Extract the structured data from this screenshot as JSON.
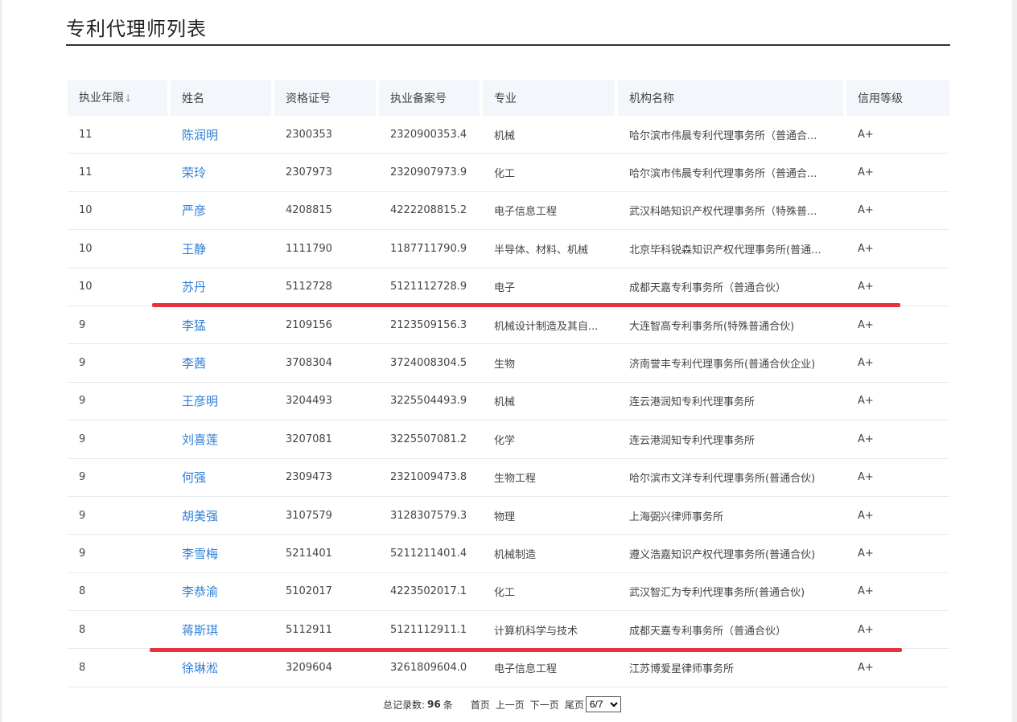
{
  "title": "专利代理师列表",
  "columns": [
    "执业年限",
    "姓名",
    "资格证号",
    "执业备案号",
    "专业",
    "机构名称",
    "信用等级"
  ],
  "sort_indicator": "arrow-down-icon",
  "rows": [
    {
      "years": "11",
      "name": "陈润明",
      "cert": "2300353",
      "record": "2320900353.4",
      "major": "机械",
      "org": "哈尔滨市伟晨专利代理事务所（普通合...",
      "credit": "A+"
    },
    {
      "years": "11",
      "name": "荣玲",
      "cert": "2307973",
      "record": "2320907973.9",
      "major": "化工",
      "org": "哈尔滨市伟晨专利代理事务所（普通合...",
      "credit": "A+"
    },
    {
      "years": "10",
      "name": "严彦",
      "cert": "4208815",
      "record": "4222208815.2",
      "major": "电子信息工程",
      "org": "武汉科皓知识产权代理事务所（特殊普...",
      "credit": "A+"
    },
    {
      "years": "10",
      "name": "王静",
      "cert": "1111790",
      "record": "1187711790.9",
      "major": "半导体、材料、机械",
      "org": "北京毕科锐森知识产权代理事务所(普通...",
      "credit": "A+"
    },
    {
      "years": "10",
      "name": "苏丹",
      "cert": "5112728",
      "record": "5121112728.9",
      "major": "电子",
      "org": "成都天嘉专利事务所（普通合伙）",
      "credit": "A+"
    },
    {
      "years": "9",
      "name": "李猛",
      "cert": "2109156",
      "record": "2123509156.3",
      "major": "机械设计制造及其自...",
      "org": "大连智高专利事务所(特殊普通合伙)",
      "credit": "A+"
    },
    {
      "years": "9",
      "name": "李茜",
      "cert": "3708304",
      "record": "3724008304.5",
      "major": "生物",
      "org": "济南誉丰专利代理事务所(普通合伙企业)",
      "credit": "A+"
    },
    {
      "years": "9",
      "name": "王彦明",
      "cert": "3204493",
      "record": "3225504493.9",
      "major": "机械",
      "org": "连云港润知专利代理事务所",
      "credit": "A+"
    },
    {
      "years": "9",
      "name": "刘喜莲",
      "cert": "3207081",
      "record": "3225507081.2",
      "major": "化学",
      "org": "连云港润知专利代理事务所",
      "credit": "A+"
    },
    {
      "years": "9",
      "name": "何强",
      "cert": "2309473",
      "record": "2321009473.8",
      "major": "生物工程",
      "org": "哈尔滨市文洋专利代理事务所(普通合伙)",
      "credit": "A+"
    },
    {
      "years": "9",
      "name": "胡美强",
      "cert": "3107579",
      "record": "3128307579.3",
      "major": "物理",
      "org": "上海弼兴律师事务所",
      "credit": "A+"
    },
    {
      "years": "9",
      "name": "李雪梅",
      "cert": "5211401",
      "record": "5211211401.4",
      "major": "机械制造",
      "org": "遵义浩嘉知识产权代理事务所(普通合伙)",
      "credit": "A+"
    },
    {
      "years": "8",
      "name": "李恭渝",
      "cert": "5102017",
      "record": "4223502017.1",
      "major": "化工",
      "org": "武汉智汇为专利代理事务所(普通合伙)",
      "credit": "A+"
    },
    {
      "years": "8",
      "name": "蒋斯琪",
      "cert": "5112911",
      "record": "5121112911.1",
      "major": "计算机科学与技术",
      "org": "成都天嘉专利事务所（普通合伙）",
      "credit": "A+"
    },
    {
      "years": "8",
      "name": "徐琳淞",
      "cert": "3209604",
      "record": "3261809604.0",
      "major": "电子信息工程",
      "org": "江苏博爱星律师事务所",
      "credit": "A+"
    }
  ],
  "pager": {
    "total_label": "总记录数:",
    "total": "96",
    "unit": "条",
    "first": "首页",
    "prev": "上一页",
    "next": "下一页",
    "last": "尾页",
    "page_select": "6/7"
  },
  "annotation_color": "#e8323c"
}
